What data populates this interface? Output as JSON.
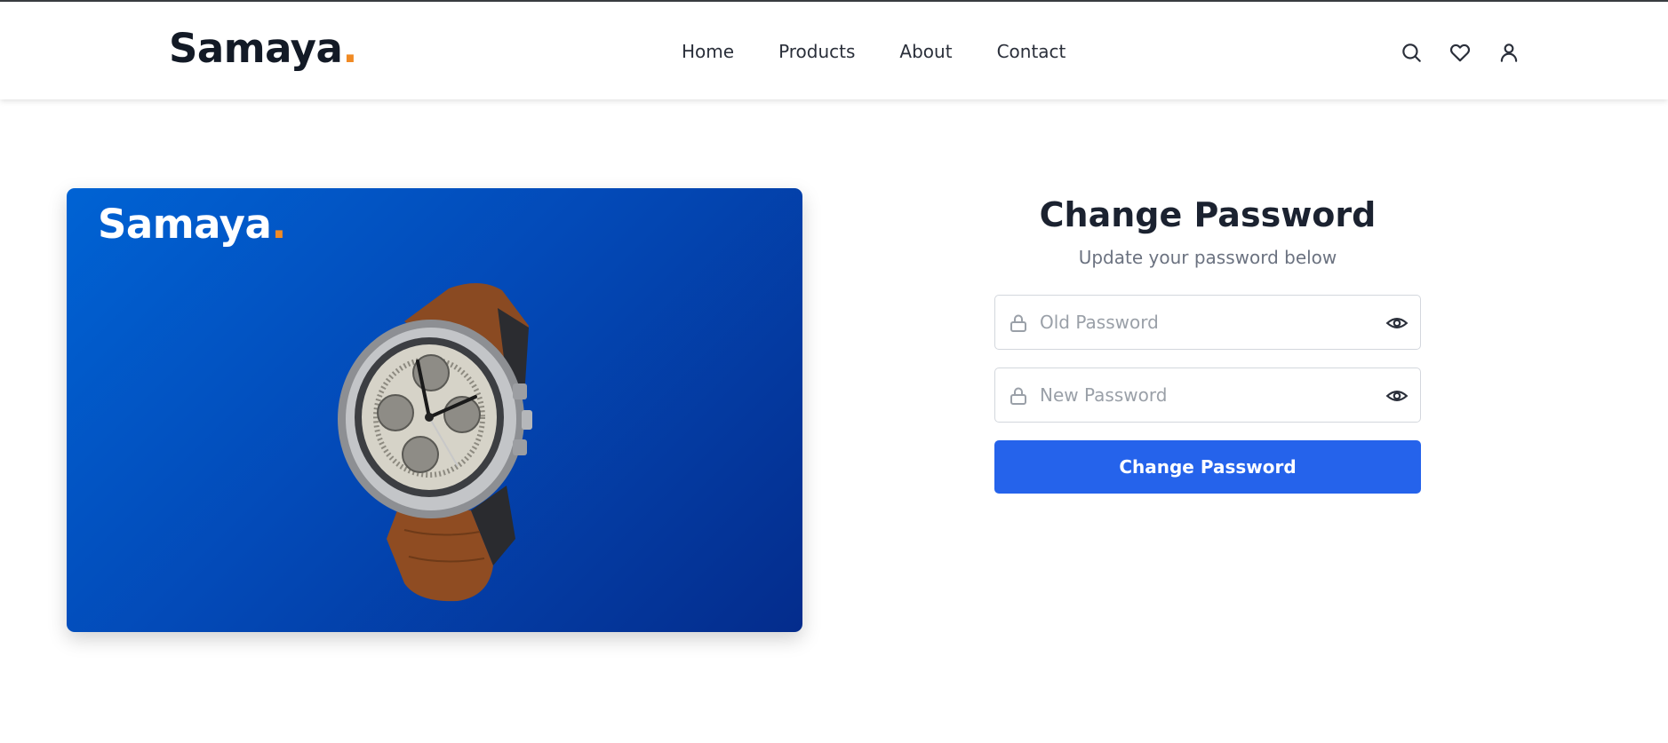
{
  "brand": {
    "name": "Samaya",
    "dot": ".",
    "accent_color": "#f08a24"
  },
  "nav": {
    "links": [
      {
        "label": "Home"
      },
      {
        "label": "Products"
      },
      {
        "label": "About"
      },
      {
        "label": "Contact"
      }
    ],
    "icons": [
      "search-icon",
      "heart-icon",
      "user-icon"
    ]
  },
  "hero": {
    "logo": {
      "name": "Samaya",
      "dot": "."
    },
    "image": "wristwatch-image",
    "background_color": "#034ab8"
  },
  "form": {
    "title": "Change Password",
    "subtitle": "Update your password below",
    "old_password": {
      "placeholder": "Old Password",
      "value": ""
    },
    "new_password": {
      "placeholder": "New Password",
      "value": ""
    },
    "submit_label": "Change Password",
    "button_color": "#2563eb"
  }
}
